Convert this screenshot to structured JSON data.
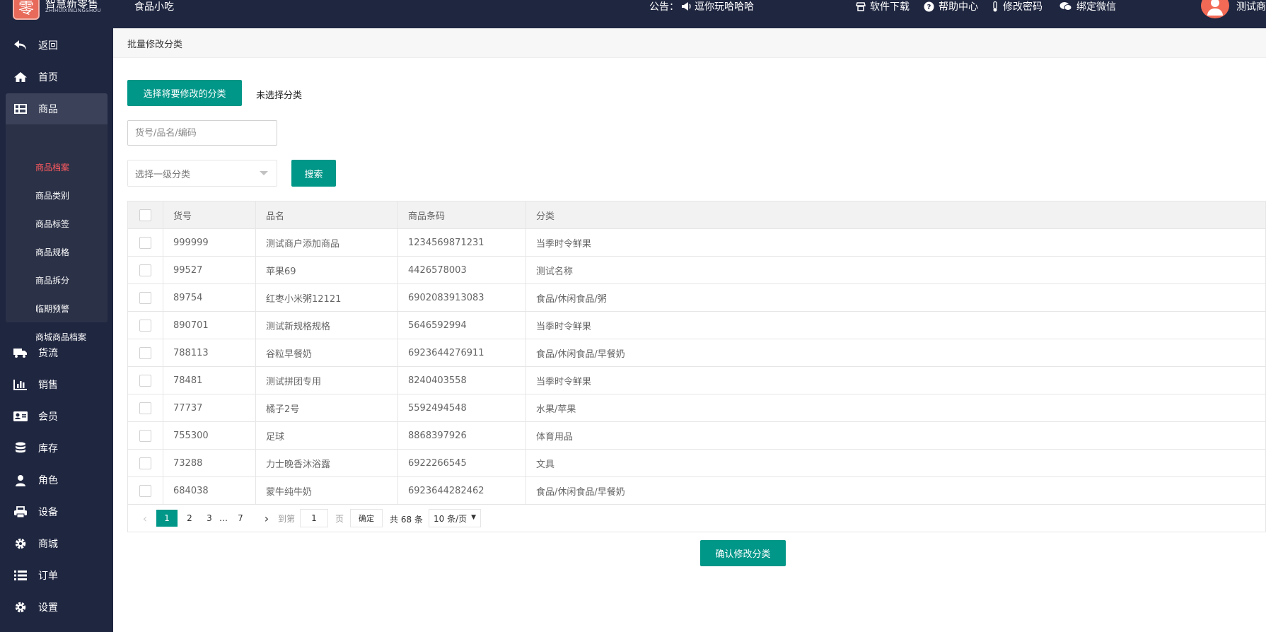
{
  "header": {
    "logo_char": "零",
    "logo_text": "智慧新零售",
    "logo_sub": "ZHIHUIXINLINGSHOU",
    "shop_name": "食品小吃",
    "notice_label": "公告：",
    "notice_text": "逗你玩哈哈哈",
    "links": [
      {
        "label": "软件下载",
        "icon": "store-icon"
      },
      {
        "label": "帮助中心",
        "icon": "help-icon"
      },
      {
        "label": "修改密码",
        "icon": "thermometer-icon"
      },
      {
        "label": "绑定微信",
        "icon": "wechat-icon"
      }
    ],
    "user_name": "测试商户"
  },
  "sidebar": {
    "items": [
      {
        "label": "返回",
        "icon": "back-icon"
      },
      {
        "label": "首页",
        "icon": "home-icon"
      },
      {
        "label": "商品",
        "icon": "table-icon"
      },
      {
        "label": "货流",
        "icon": "truck-icon"
      },
      {
        "label": "销售",
        "icon": "bar-chart-icon"
      },
      {
        "label": "会员",
        "icon": "id-card-icon"
      },
      {
        "label": "库存",
        "icon": "database-icon"
      },
      {
        "label": "角色",
        "icon": "user-icon"
      },
      {
        "label": "设备",
        "icon": "printer-icon"
      },
      {
        "label": "商城",
        "icon": "gear-icon"
      },
      {
        "label": "订单",
        "icon": "list-icon"
      },
      {
        "label": "设置",
        "icon": "gear-icon"
      }
    ],
    "submenu": [
      "商品档案",
      "商品类别",
      "商品标签",
      "商品规格",
      "商品拆分",
      "临期预警",
      "商城商品档案"
    ]
  },
  "main": {
    "breadcrumb": "批量修改分类",
    "tab_choose": "选择将要修改的分类",
    "tab_unselected": "未选择分类",
    "search_placeholder": "货号/品名/编码",
    "select_placeholder": "选择一级分类",
    "search_button": "搜索",
    "confirm_button": "确认修改分类"
  },
  "table": {
    "headers": [
      "货号",
      "品名",
      "商品条码",
      "分类"
    ],
    "rows": [
      [
        "999999",
        "测试商户添加商品",
        "1234569871231",
        "当季时令鲜果"
      ],
      [
        "99527",
        "苹果69",
        "4426578003",
        "测试名称"
      ],
      [
        "89754",
        "红枣小米粥12121",
        "6902083913083",
        "食品/休闲食品/粥"
      ],
      [
        "890701",
        "测试新规格规格",
        "5646592994",
        "当季时令鲜果"
      ],
      [
        "788113",
        "谷粒早餐奶",
        "6923644276911",
        "食品/休闲食品/早餐奶"
      ],
      [
        "78481",
        "测试拼团专用",
        "8240403558",
        "当季时令鲜果"
      ],
      [
        "77737",
        "橘子2号",
        "5592494548",
        "水果/苹果"
      ],
      [
        "755300",
        "足球",
        "8868397926",
        "体育用品"
      ],
      [
        "73288",
        "力士晚香沐浴露",
        "6922266545",
        "文具"
      ],
      [
        "684038",
        "蒙牛纯牛奶",
        "6923644282462",
        "食品/休闲食品/早餐奶"
      ]
    ]
  },
  "pagination": {
    "prev": "‹",
    "next": "›",
    "current": "1",
    "pages": [
      "2",
      "3"
    ],
    "ellipsis": "…",
    "last": "7",
    "goto_label": "到第",
    "goto_value": "1",
    "page_label": "页",
    "ok_label": "确定",
    "total": "共 68 条",
    "page_size": "10 条/页"
  },
  "colors": {
    "primary": "#009688",
    "sidebar_bg": "#1f2640",
    "active_sub": "#ff5a5f"
  }
}
